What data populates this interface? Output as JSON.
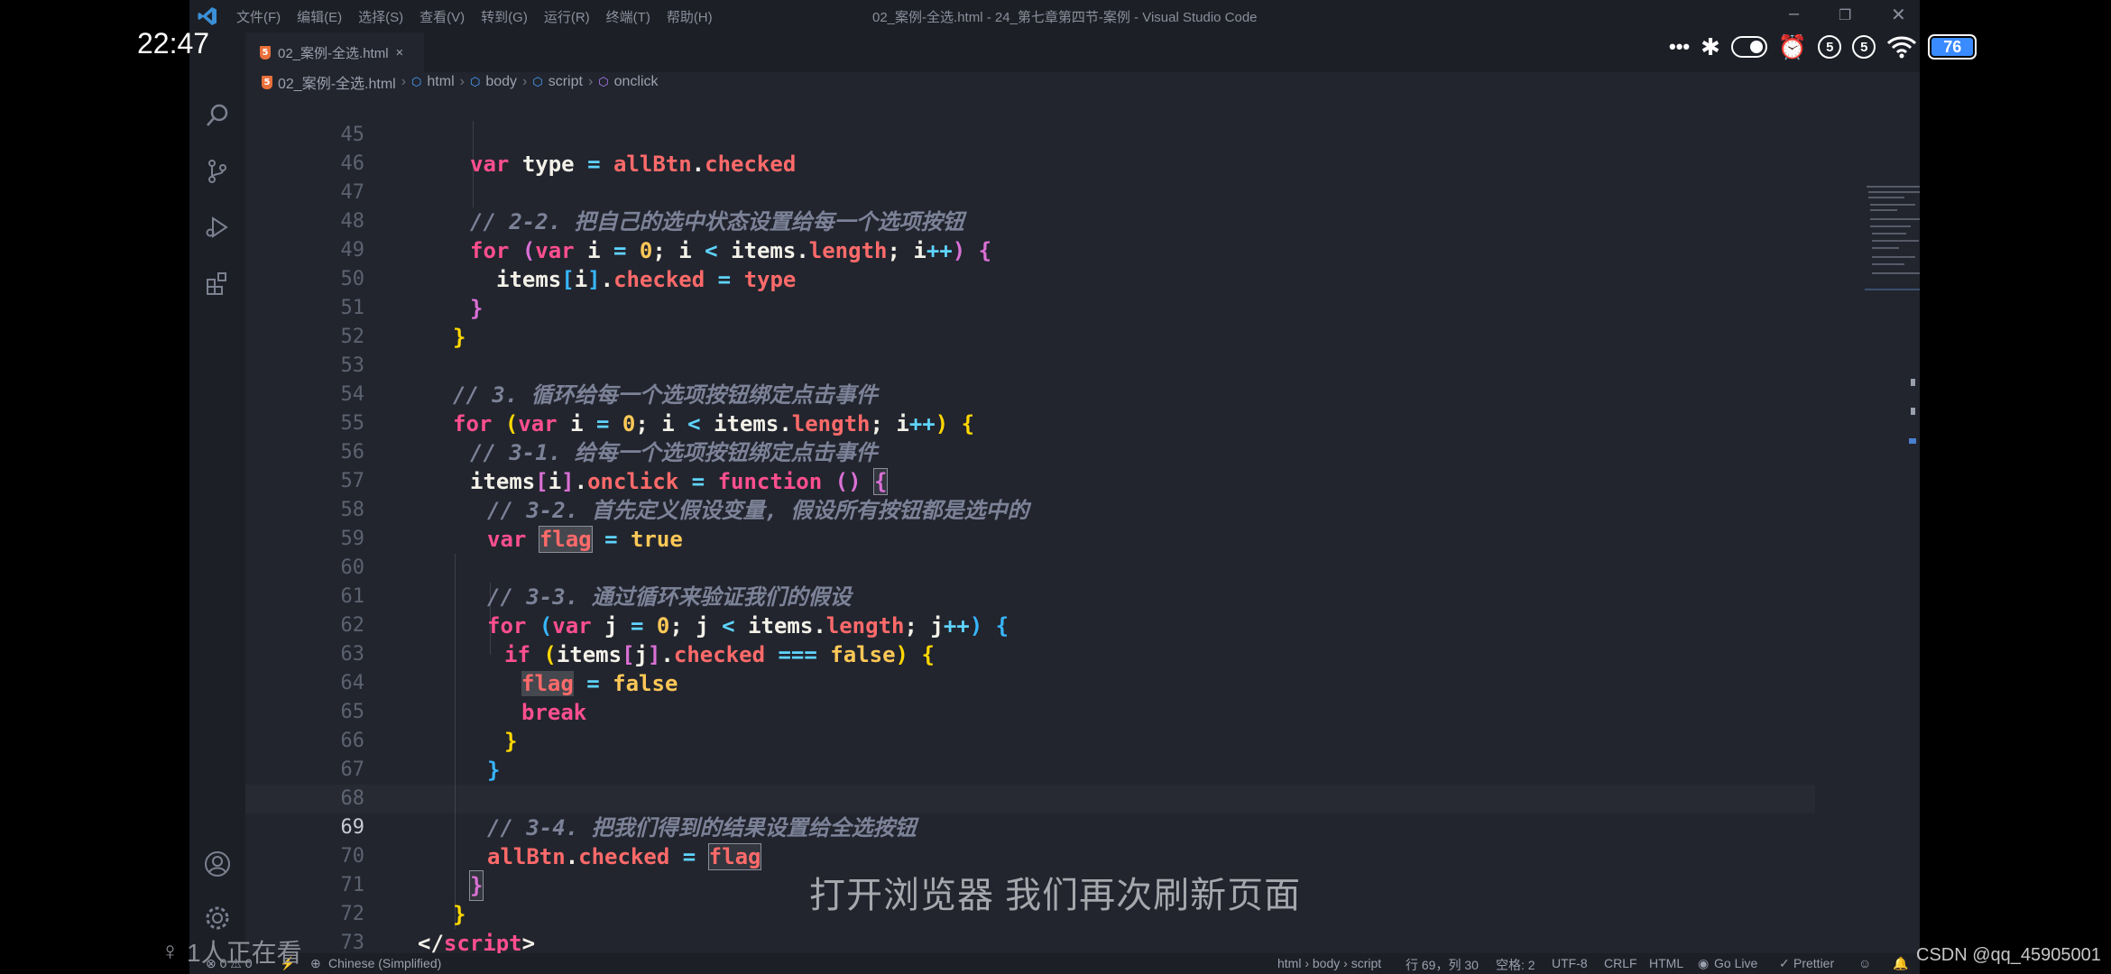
{
  "phone": {
    "time": "22:47",
    "notification_badge_1": "5",
    "notification_badge_2": "5",
    "battery": "76",
    "more_glyph": "•••"
  },
  "window": {
    "title": "02_案例-全选.html - 24_第七章第四节-案例 - Visual Studio Code",
    "menu": [
      "文件(F)",
      "编辑(E)",
      "选择(S)",
      "查看(V)",
      "转到(G)",
      "运行(R)",
      "终端(T)",
      "帮助(H)"
    ]
  },
  "tab": {
    "label": "02_案例-全选.html",
    "close": "×"
  },
  "breadcrumb": [
    "02_案例-全选.html",
    "html",
    "body",
    "script",
    "onclick"
  ],
  "editor": {
    "current_line": "69",
    "lines": [
      {
        "n": "45"
      },
      {
        "n": "46"
      },
      {
        "n": "47"
      },
      {
        "n": "48"
      },
      {
        "n": "49"
      },
      {
        "n": "50"
      },
      {
        "n": "51"
      },
      {
        "n": "52"
      },
      {
        "n": "53"
      },
      {
        "n": "54"
      },
      {
        "n": "55"
      },
      {
        "n": "56"
      },
      {
        "n": "57"
      },
      {
        "n": "58"
      },
      {
        "n": "59"
      },
      {
        "n": "60"
      },
      {
        "n": "61"
      },
      {
        "n": "62"
      },
      {
        "n": "63"
      },
      {
        "n": "64"
      },
      {
        "n": "65"
      },
      {
        "n": "66"
      },
      {
        "n": "67"
      },
      {
        "n": "68"
      },
      {
        "n": "69"
      },
      {
        "n": "70"
      },
      {
        "n": "71"
      },
      {
        "n": "72"
      },
      {
        "n": "73"
      }
    ],
    "tokens": {
      "var": "var",
      "for": "for",
      "if": "if",
      "break": "break",
      "function": "function",
      "type": "type",
      "allBtn": "allBtn",
      "checked": "checked",
      "items": "items",
      "length": "length",
      "onclick": "onclick",
      "flag": "flag",
      "true": "true",
      "false": "false",
      "i": "i",
      "j": "j",
      "zero": "0",
      "c47": "// 2-2. 把自己的选中状态设置给每一个选项按钮",
      "c53": "// 3. 循环给每一个选项按钮绑定点击事件",
      "c55": "// 3-1. 给每一个选项按钮绑定点击事件",
      "c57": "// 3-2. 首先定义假设变量, 假设所有按钮都是选中的",
      "c60": "// 3-3. 通过循环来验证我们的假设",
      "c68": "// 3-4. 把我们得到的结果设置给全选按钮",
      "script": "script",
      "body": "body"
    }
  },
  "status": {
    "problems": "⊗ 0 ⚠ 0",
    "language_pack": "Chinese (Simplified)",
    "path": "html › body › script",
    "position": "行 69，列 30",
    "spaces": "空格: 2",
    "encoding": "UTF-8",
    "eol": "CRLF",
    "language": "HTML",
    "golive": "Go Live",
    "prettier": "Prettier"
  },
  "overlay": {
    "subtitle": "打开浏览器 我们再次刷新页面",
    "viewers": "1人正在看",
    "watermark": "CSDN @qq_45905001"
  },
  "colors": {
    "keyword": "#ff4f8f",
    "property": "#ff6a6a",
    "number": "#ffc857",
    "comment": "#7c8297",
    "background": "#22252e"
  }
}
